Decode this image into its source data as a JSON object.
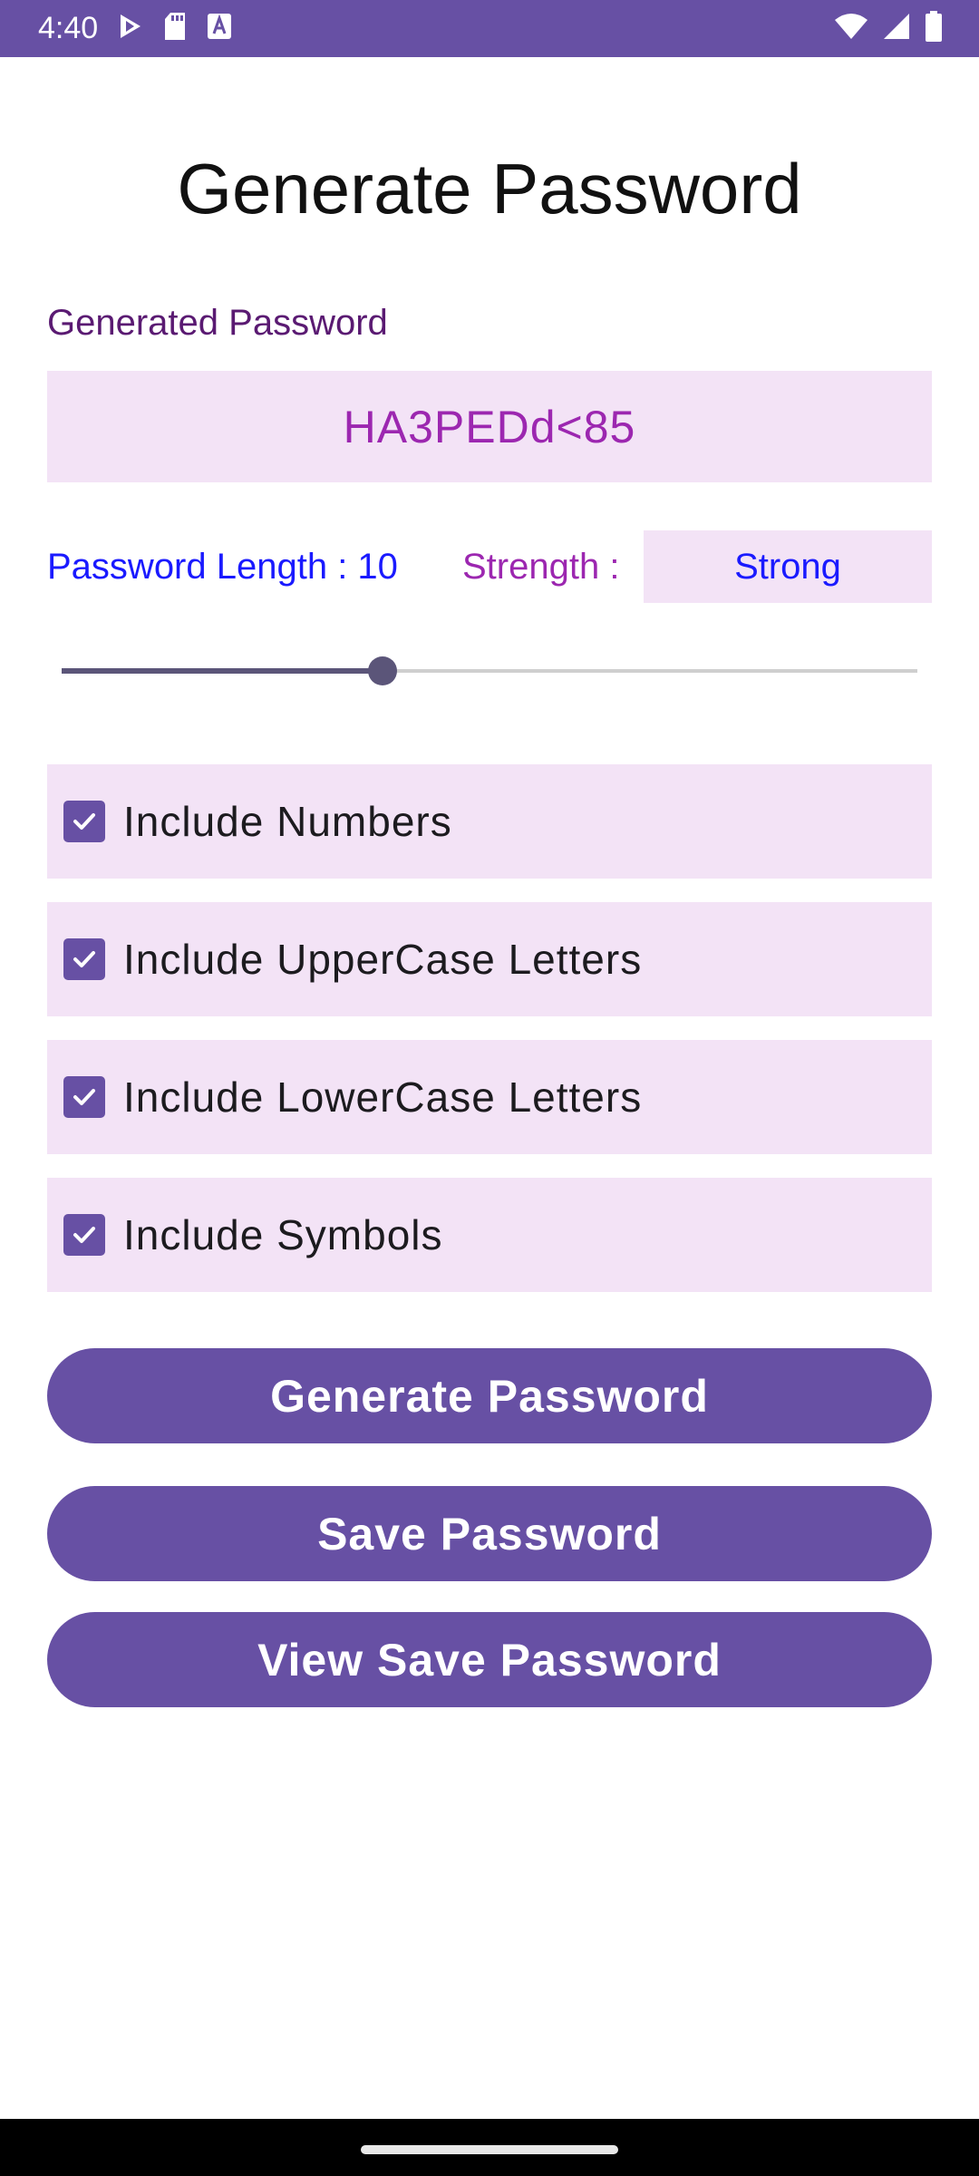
{
  "status_bar": {
    "time": "4:40",
    "left_icons": [
      "play-protect-icon",
      "sd-card-icon",
      "keyboard-a-icon"
    ],
    "right_icons": [
      "wifi-icon",
      "cell-signal-icon",
      "battery-icon"
    ]
  },
  "title": "Generate Password",
  "password_field": {
    "label": "Generated Password",
    "value": "HA3PEDd<85"
  },
  "length": {
    "label": "Password Length : 10",
    "value": 10,
    "slider_fraction": 0.375
  },
  "strength": {
    "label": "Strength :",
    "value": "Strong"
  },
  "options": [
    {
      "label": "Include Numbers",
      "checked": true
    },
    {
      "label": "Include UpperCase Letters",
      "checked": true
    },
    {
      "label": "Include LowerCase Letters",
      "checked": true
    },
    {
      "label": "Include Symbols",
      "checked": true
    }
  ],
  "buttons": {
    "generate": "Generate Password",
    "save": "Save Password",
    "view_saved": "View Save Password"
  },
  "colors": {
    "primary": "#6750a4",
    "field_background": "#f3e3f6",
    "password_text": "#9c27b0",
    "length_text": "#1a1aff"
  }
}
